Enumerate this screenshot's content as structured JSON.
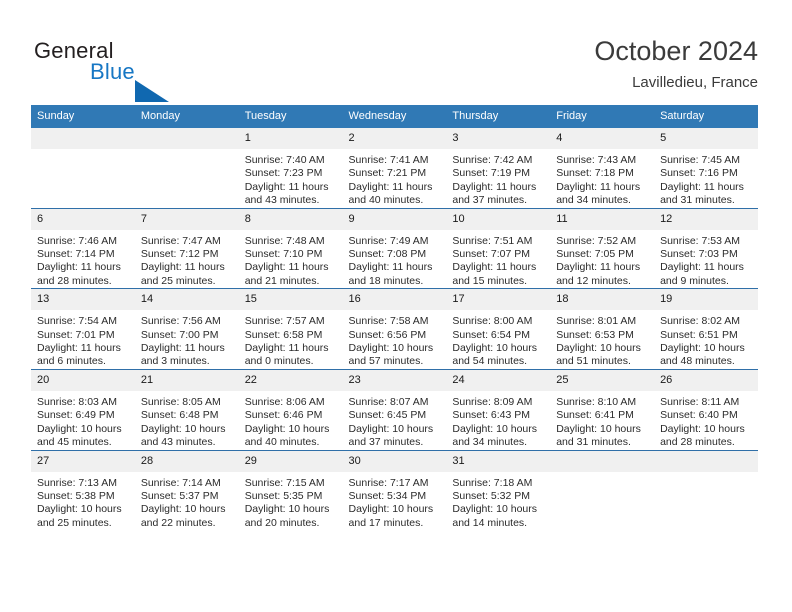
{
  "brand": {
    "name_part1": "General",
    "name_part2": "Blue",
    "accent_color": "#1777c4",
    "triangle_color": "#1068b0"
  },
  "header": {
    "title": "October 2024",
    "subtitle": "Lavilledieu, France"
  },
  "calendar": {
    "header_color": "#3079b5",
    "row_divider_color": "#2f6fa8",
    "date_band_color": "#f0f0f0",
    "weekdays": [
      "Sunday",
      "Monday",
      "Tuesday",
      "Wednesday",
      "Thursday",
      "Friday",
      "Saturday"
    ],
    "weeks": [
      [
        {
          "day": "",
          "blank": true
        },
        {
          "day": "",
          "blank": true
        },
        {
          "day": "1",
          "sunrise": "Sunrise: 7:40 AM",
          "sunset": "Sunset: 7:23 PM",
          "daylight": "Daylight: 11 hours and 43 minutes."
        },
        {
          "day": "2",
          "sunrise": "Sunrise: 7:41 AM",
          "sunset": "Sunset: 7:21 PM",
          "daylight": "Daylight: 11 hours and 40 minutes."
        },
        {
          "day": "3",
          "sunrise": "Sunrise: 7:42 AM",
          "sunset": "Sunset: 7:19 PM",
          "daylight": "Daylight: 11 hours and 37 minutes."
        },
        {
          "day": "4",
          "sunrise": "Sunrise: 7:43 AM",
          "sunset": "Sunset: 7:18 PM",
          "daylight": "Daylight: 11 hours and 34 minutes."
        },
        {
          "day": "5",
          "sunrise": "Sunrise: 7:45 AM",
          "sunset": "Sunset: 7:16 PM",
          "daylight": "Daylight: 11 hours and 31 minutes."
        }
      ],
      [
        {
          "day": "6",
          "sunrise": "Sunrise: 7:46 AM",
          "sunset": "Sunset: 7:14 PM",
          "daylight": "Daylight: 11 hours and 28 minutes."
        },
        {
          "day": "7",
          "sunrise": "Sunrise: 7:47 AM",
          "sunset": "Sunset: 7:12 PM",
          "daylight": "Daylight: 11 hours and 25 minutes."
        },
        {
          "day": "8",
          "sunrise": "Sunrise: 7:48 AM",
          "sunset": "Sunset: 7:10 PM",
          "daylight": "Daylight: 11 hours and 21 minutes."
        },
        {
          "day": "9",
          "sunrise": "Sunrise: 7:49 AM",
          "sunset": "Sunset: 7:08 PM",
          "daylight": "Daylight: 11 hours and 18 minutes."
        },
        {
          "day": "10",
          "sunrise": "Sunrise: 7:51 AM",
          "sunset": "Sunset: 7:07 PM",
          "daylight": "Daylight: 11 hours and 15 minutes."
        },
        {
          "day": "11",
          "sunrise": "Sunrise: 7:52 AM",
          "sunset": "Sunset: 7:05 PM",
          "daylight": "Daylight: 11 hours and 12 minutes."
        },
        {
          "day": "12",
          "sunrise": "Sunrise: 7:53 AM",
          "sunset": "Sunset: 7:03 PM",
          "daylight": "Daylight: 11 hours and 9 minutes."
        }
      ],
      [
        {
          "day": "13",
          "sunrise": "Sunrise: 7:54 AM",
          "sunset": "Sunset: 7:01 PM",
          "daylight": "Daylight: 11 hours and 6 minutes."
        },
        {
          "day": "14",
          "sunrise": "Sunrise: 7:56 AM",
          "sunset": "Sunset: 7:00 PM",
          "daylight": "Daylight: 11 hours and 3 minutes."
        },
        {
          "day": "15",
          "sunrise": "Sunrise: 7:57 AM",
          "sunset": "Sunset: 6:58 PM",
          "daylight": "Daylight: 11 hours and 0 minutes."
        },
        {
          "day": "16",
          "sunrise": "Sunrise: 7:58 AM",
          "sunset": "Sunset: 6:56 PM",
          "daylight": "Daylight: 10 hours and 57 minutes."
        },
        {
          "day": "17",
          "sunrise": "Sunrise: 8:00 AM",
          "sunset": "Sunset: 6:54 PM",
          "daylight": "Daylight: 10 hours and 54 minutes."
        },
        {
          "day": "18",
          "sunrise": "Sunrise: 8:01 AM",
          "sunset": "Sunset: 6:53 PM",
          "daylight": "Daylight: 10 hours and 51 minutes."
        },
        {
          "day": "19",
          "sunrise": "Sunrise: 8:02 AM",
          "sunset": "Sunset: 6:51 PM",
          "daylight": "Daylight: 10 hours and 48 minutes."
        }
      ],
      [
        {
          "day": "20",
          "sunrise": "Sunrise: 8:03 AM",
          "sunset": "Sunset: 6:49 PM",
          "daylight": "Daylight: 10 hours and 45 minutes."
        },
        {
          "day": "21",
          "sunrise": "Sunrise: 8:05 AM",
          "sunset": "Sunset: 6:48 PM",
          "daylight": "Daylight: 10 hours and 43 minutes."
        },
        {
          "day": "22",
          "sunrise": "Sunrise: 8:06 AM",
          "sunset": "Sunset: 6:46 PM",
          "daylight": "Daylight: 10 hours and 40 minutes."
        },
        {
          "day": "23",
          "sunrise": "Sunrise: 8:07 AM",
          "sunset": "Sunset: 6:45 PM",
          "daylight": "Daylight: 10 hours and 37 minutes."
        },
        {
          "day": "24",
          "sunrise": "Sunrise: 8:09 AM",
          "sunset": "Sunset: 6:43 PM",
          "daylight": "Daylight: 10 hours and 34 minutes."
        },
        {
          "day": "25",
          "sunrise": "Sunrise: 8:10 AM",
          "sunset": "Sunset: 6:41 PM",
          "daylight": "Daylight: 10 hours and 31 minutes."
        },
        {
          "day": "26",
          "sunrise": "Sunrise: 8:11 AM",
          "sunset": "Sunset: 6:40 PM",
          "daylight": "Daylight: 10 hours and 28 minutes."
        }
      ],
      [
        {
          "day": "27",
          "sunrise": "Sunrise: 7:13 AM",
          "sunset": "Sunset: 5:38 PM",
          "daylight": "Daylight: 10 hours and 25 minutes."
        },
        {
          "day": "28",
          "sunrise": "Sunrise: 7:14 AM",
          "sunset": "Sunset: 5:37 PM",
          "daylight": "Daylight: 10 hours and 22 minutes."
        },
        {
          "day": "29",
          "sunrise": "Sunrise: 7:15 AM",
          "sunset": "Sunset: 5:35 PM",
          "daylight": "Daylight: 10 hours and 20 minutes."
        },
        {
          "day": "30",
          "sunrise": "Sunrise: 7:17 AM",
          "sunset": "Sunset: 5:34 PM",
          "daylight": "Daylight: 10 hours and 17 minutes."
        },
        {
          "day": "31",
          "sunrise": "Sunrise: 7:18 AM",
          "sunset": "Sunset: 5:32 PM",
          "daylight": "Daylight: 10 hours and 14 minutes."
        },
        {
          "day": "",
          "blank": true
        },
        {
          "day": "",
          "blank": true
        }
      ]
    ]
  }
}
